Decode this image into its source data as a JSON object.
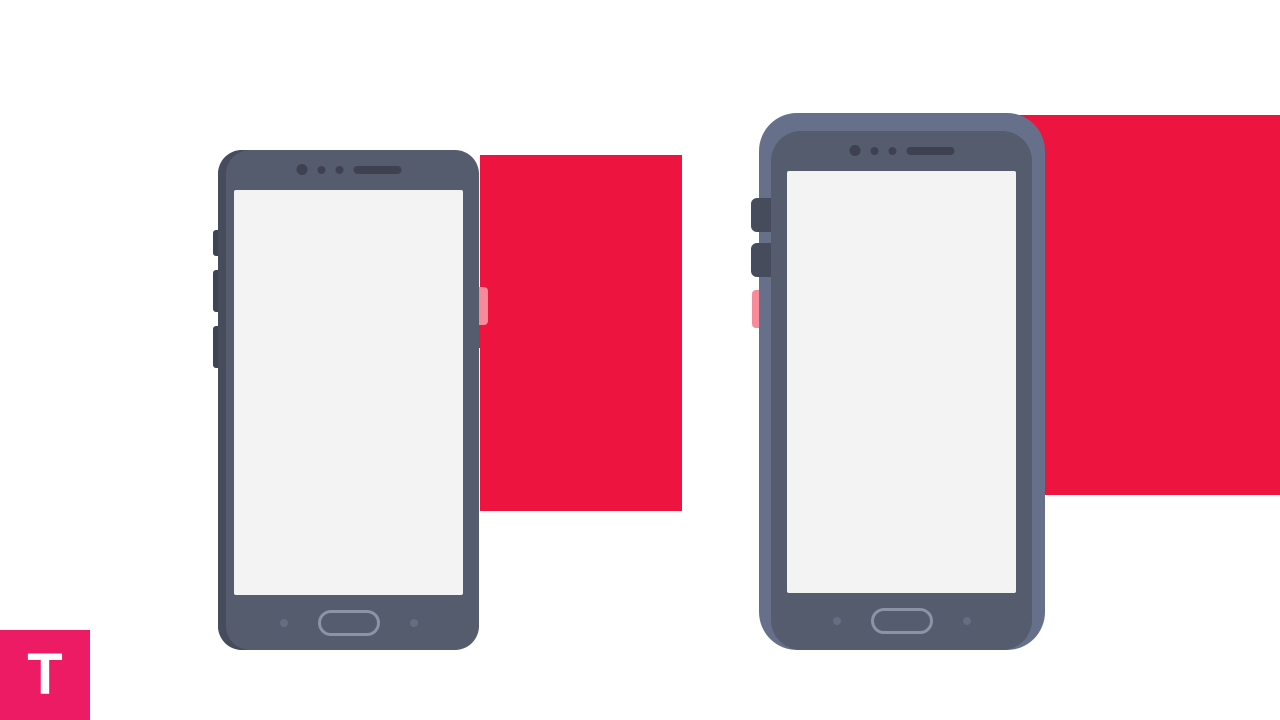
{
  "badge": {
    "letter": "T"
  },
  "colors": {
    "accent_pink": "#ed1a64",
    "accent_red": "#ed153f",
    "accent_salmon": "#f98a99",
    "phone_body": "#555c6e",
    "phone_body_dark": "#474c5c",
    "phone_case": "#66708a",
    "screen": "#f3f3f3"
  },
  "icons": {
    "badge": "letter-t-icon",
    "phone_left": "smartphone-icon",
    "phone_right": "smartphone-in-case-icon",
    "red_shape": "decorative-shape-icon"
  }
}
